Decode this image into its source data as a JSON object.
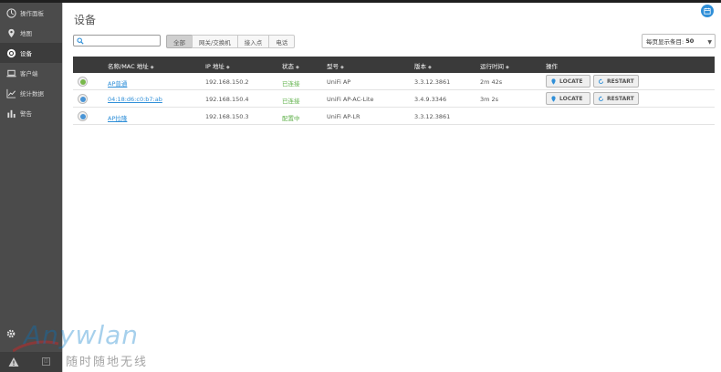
{
  "sidebar": {
    "items": [
      {
        "icon": "dashboard-icon",
        "label": "操作面板",
        "active": false
      },
      {
        "icon": "map-pin-icon",
        "label": "地图",
        "active": false
      },
      {
        "icon": "devices-icon",
        "label": "设备",
        "active": true
      },
      {
        "icon": "laptop-icon",
        "label": "客户端",
        "active": false
      },
      {
        "icon": "line-chart-icon",
        "label": "统计数据",
        "active": false
      },
      {
        "icon": "bar-chart-icon",
        "label": "警告",
        "active": false
      }
    ]
  },
  "page": {
    "title": "设备"
  },
  "search": {
    "value": "",
    "placeholder": ""
  },
  "filters": [
    {
      "label": "全部",
      "active": true
    },
    {
      "label": "网关/交换机",
      "active": false
    },
    {
      "label": "接入点",
      "active": false
    },
    {
      "label": "电话",
      "active": false
    }
  ],
  "perpage": {
    "label": "每页显示条目:",
    "value": "50"
  },
  "table": {
    "headers": {
      "name": "名称/MAC 地址",
      "ip": "IP 地址",
      "status": "状态",
      "model": "型号",
      "version": "版本",
      "uptime": "运行时间",
      "actions": "操作"
    },
    "rows": [
      {
        "name": "AP普通",
        "ip": "192.168.150.2",
        "status": "已连接",
        "model": "UniFi AP",
        "version": "3.3.12.3861",
        "uptime": "2m 42s",
        "actions": true,
        "dot": "green"
      },
      {
        "name": "04:18:d6:c0:b7:ab",
        "ip": "192.168.150.4",
        "status": "已连接",
        "model": "UniFi AP-AC-Lite",
        "version": "3.4.9.3346",
        "uptime": "3m 2s",
        "actions": true,
        "dot": "blue"
      },
      {
        "name": "AP拉隆",
        "ip": "192.168.150.3",
        "status": "配置中",
        "model": "UniFi AP-LR",
        "version": "3.3.12.3861",
        "uptime": "",
        "actions": false,
        "dot": "blue"
      }
    ],
    "locate_label": "LOCATE",
    "restart_label": "RESTART"
  },
  "watermark": {
    "brand": "Anywlan",
    "sub": "随时随地无线"
  },
  "colors": {
    "accent": "#2f8fd8",
    "connected": "#5fb14a",
    "sidebar": "#4b4b4b",
    "header": "#3a3a3a"
  }
}
